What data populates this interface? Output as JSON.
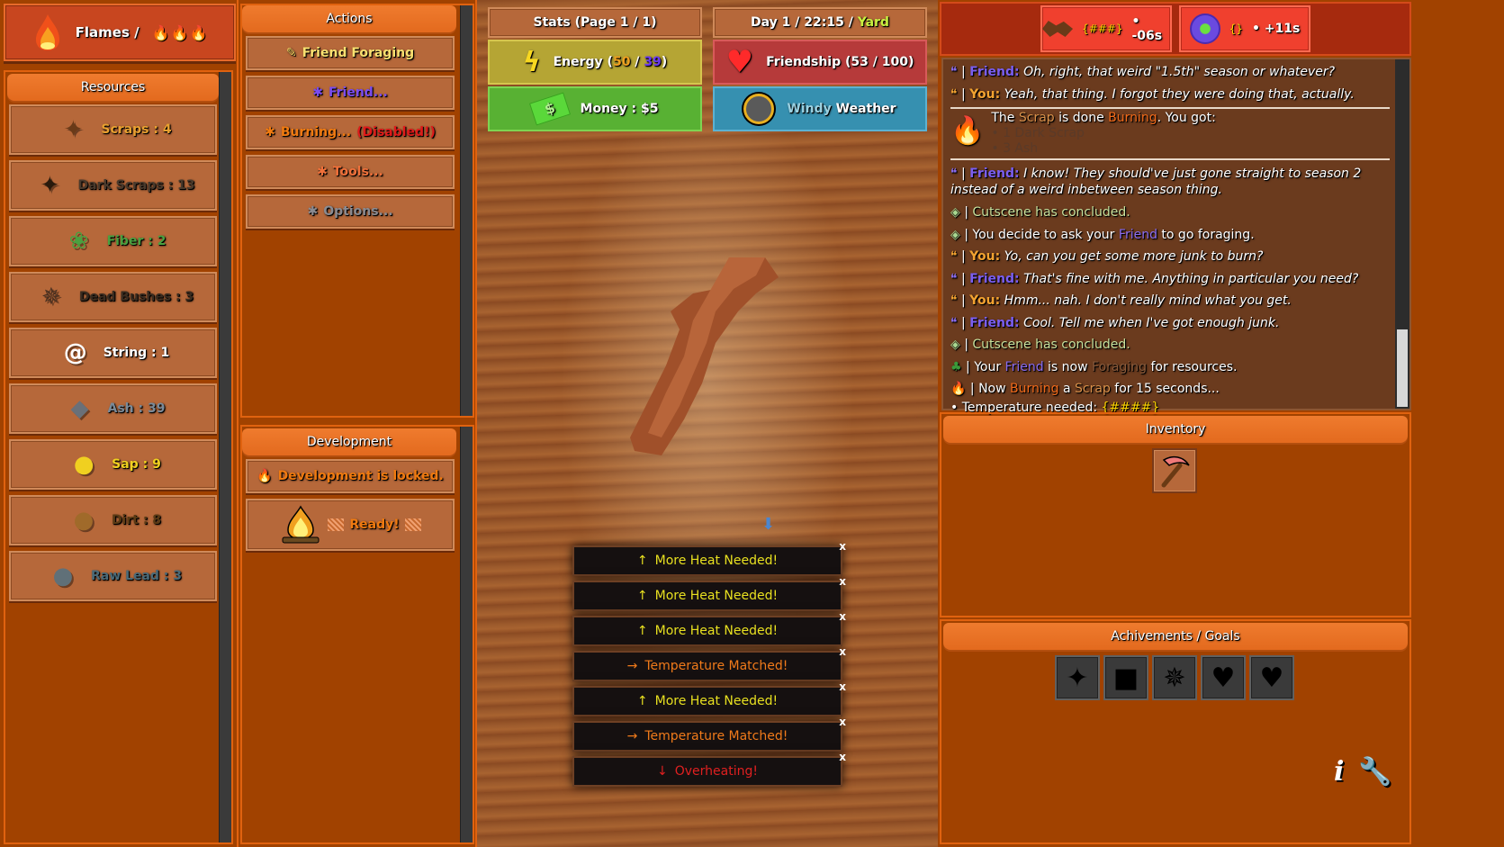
{
  "header": {
    "title": "Flames /",
    "flame_count_icons": [
      "flame-icon",
      "flame-icon",
      "flame-icon"
    ]
  },
  "resources": {
    "title": "Resources",
    "items": [
      {
        "label": "Scraps : 4",
        "icon": "scrap-icon",
        "color": "#e8a030"
      },
      {
        "label": "Dark Scraps : 13",
        "icon": "dark-scrap-icon",
        "color": "#4a3a2c"
      },
      {
        "label": "Fiber : 2",
        "icon": "fiber-icon",
        "color": "#4aa040"
      },
      {
        "label": "Dead Bushes : 3",
        "icon": "dead-bush-icon",
        "color": "#3a2c20"
      },
      {
        "label": "String : 1",
        "icon": "string-icon",
        "color": "#ffffff"
      },
      {
        "label": "Ash : 39",
        "icon": "ash-icon",
        "color": "#7a8a98"
      },
      {
        "label": "Sap : 9",
        "icon": "sap-icon",
        "color": "#f0d020"
      },
      {
        "label": "Dirt : 8",
        "icon": "dirt-icon",
        "color": "#5a3a14"
      },
      {
        "label": "Raw Lead : 3",
        "icon": "raw-lead-icon",
        "color": "#4a6a78"
      }
    ]
  },
  "actions": {
    "title": "Actions",
    "buttons": [
      {
        "prefix": "✎",
        "label": "Friend Foraging",
        "color": "#f8e070",
        "prefix_color": "#f0d060"
      },
      {
        "prefix": "✱",
        "label": "Friend...",
        "color": "#7a4cf0",
        "prefix_color": "#7a4cf0"
      },
      {
        "prefix": "✱",
        "label": "Burning...",
        "suffix": "(Disabled!)",
        "color": "#f07a10",
        "prefix_color": "#f07a10",
        "suffix_color": "#e01a1a"
      },
      {
        "prefix": "✱",
        "label": "Tools...",
        "color": "#f0703a",
        "prefix_color": "#f0703a"
      },
      {
        "prefix": "✱",
        "label": "Options...",
        "color": "#8a8a90",
        "prefix_color": "#8a8a90"
      }
    ]
  },
  "development": {
    "title": "Development",
    "locked_label": "Development is locked.",
    "ready_label": "Ready!"
  },
  "stats": {
    "header": "Stats (Page 1 / 1)",
    "day_prefix": "Day 1 / 22:15 /",
    "location": "Yard",
    "energy": {
      "label": "Energy (",
      "current": "50",
      "sep": " / ",
      "max": "39",
      "close": ")"
    },
    "friendship": {
      "label": "Friendship (53 / 100)"
    },
    "money": {
      "label": "Money : $5"
    },
    "weather": {
      "kind": "Windy",
      "label": "Weather"
    }
  },
  "notifications": [
    {
      "arrow": "↑",
      "text": "More Heat Needed!",
      "color": "#e8e020"
    },
    {
      "arrow": "↑",
      "text": "More Heat Needed!",
      "color": "#e8e020"
    },
    {
      "arrow": "↑",
      "text": "More Heat Needed!",
      "color": "#e8e020"
    },
    {
      "arrow": "→",
      "text": "Temperature Matched!",
      "color": "#f07a1a"
    },
    {
      "arrow": "↑",
      "text": "More Heat Needed!",
      "color": "#e8e020"
    },
    {
      "arrow": "→",
      "text": "Temperature Matched!",
      "color": "#f07a1a"
    },
    {
      "arrow": "↓",
      "text": "Overheating!",
      "color": "#e02020"
    }
  ],
  "notification_close": "x",
  "timers": [
    {
      "icon": "scrap-icon",
      "temp": "{###}",
      "value": "• -06s"
    },
    {
      "icon": "friend-orb-icon",
      "temp": "{}",
      "value": "• +11s"
    }
  ],
  "log": {
    "l1": {
      "quote": "❝",
      "speaker": "Friend:",
      "text": "Oh, right, that weird \"1.5th\" season or whatever?"
    },
    "l2": {
      "quote": "❝",
      "speaker": "You:",
      "text": "Yeah, that thing. I forgot they were doing that, actually."
    },
    "burn_result": {
      "a": "The",
      "scrap": "Scrap",
      "b": "is done",
      "burning": "Burning",
      "c": ". You got:",
      "items": [
        "• 1 Dark Scrap",
        "• 3 Ash"
      ]
    },
    "l3": {
      "quote": "❝",
      "speaker": "Friend:",
      "text": "I know! They should've just gone straight to season 2 instead of a weird inbetween season thing."
    },
    "l4": {
      "icon": "◈",
      "text": "Cutscene has concluded."
    },
    "l5": {
      "icon": "◈",
      "a": "You decide to ask your",
      "friend": "Friend",
      "b": "to go foraging."
    },
    "l6": {
      "quote": "❝",
      "speaker": "You:",
      "text": "Yo, can you get some more junk to burn?"
    },
    "l7": {
      "quote": "❝",
      "speaker": "Friend:",
      "text": "That's fine with me. Anything in particular you need?"
    },
    "l8": {
      "quote": "❝",
      "speaker": "You:",
      "text": "Hmm... nah. I don't really mind what you get."
    },
    "l9": {
      "quote": "❝",
      "speaker": "Friend:",
      "text": "Cool. Tell me when I've got enough junk."
    },
    "l10": {
      "icon": "◈",
      "text": "Cutscene has concluded."
    },
    "l11": {
      "a": "Your",
      "friend": "Friend",
      "b": "is now",
      "foraging": "Foraging",
      "c": "for resources."
    },
    "l12": {
      "a": "Now",
      "burning": "Burning",
      "b": "a",
      "scrap": "Scrap",
      "c": "for 15 seconds..."
    },
    "l13": {
      "a": "• Temperature needed:",
      "hash": "{####}"
    },
    "pipe": "|"
  },
  "inventory": {
    "title": "Inventory",
    "items": [
      "pickaxe-icon"
    ]
  },
  "achievements": {
    "title": "Achivements / Goals",
    "slots": 5
  },
  "corner": {
    "info": "i",
    "settings": "🔧"
  }
}
